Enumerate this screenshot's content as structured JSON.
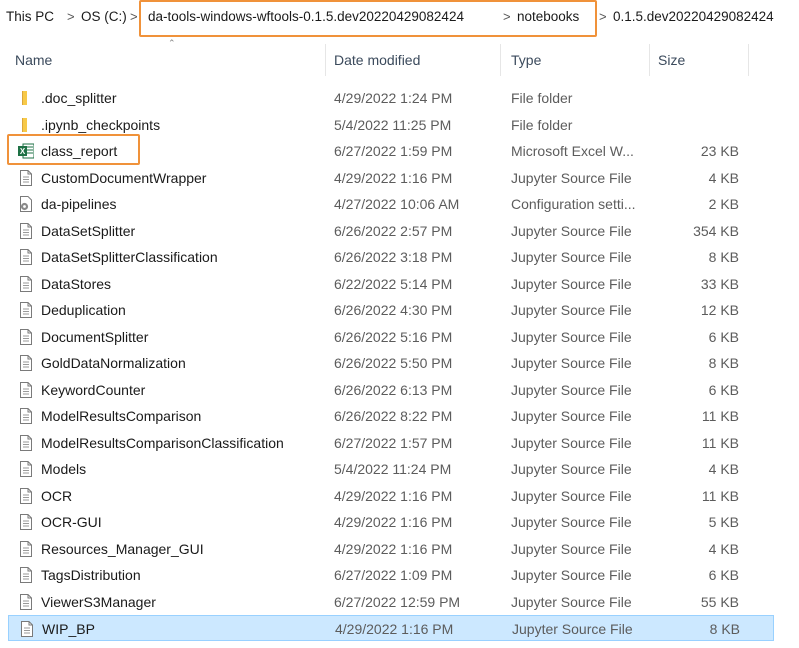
{
  "breadcrumb": {
    "items": [
      "This PC",
      "OS (C:)",
      "da-tools-windows-wftools-0.1.5.dev20220429082424",
      "notebooks",
      "0.1.5.dev20220429082424"
    ],
    "separator": ">"
  },
  "columns": {
    "name": "Name",
    "date": "Date modified",
    "type": "Type",
    "size": "Size"
  },
  "highlight_color": "#f0923a",
  "files": [
    {
      "name": ".doc_splitter",
      "date": "4/29/2022 1:24 PM",
      "type": "File folder",
      "size": "",
      "icon": "folder-icon"
    },
    {
      "name": ".ipynb_checkpoints",
      "date": "5/4/2022 11:25 PM",
      "type": "File folder",
      "size": "",
      "icon": "folder-icon"
    },
    {
      "name": "class_report",
      "date": "6/27/2022 1:59 PM",
      "type": "Microsoft Excel W...",
      "size": "23 KB",
      "icon": "excel-file-icon"
    },
    {
      "name": "CustomDocumentWrapper",
      "date": "4/29/2022 1:16 PM",
      "type": "Jupyter Source File",
      "size": "4 KB",
      "icon": "document-icon"
    },
    {
      "name": "da-pipelines",
      "date": "4/27/2022 10:06 AM",
      "type": "Configuration setti...",
      "size": "2 KB",
      "icon": "config-file-icon"
    },
    {
      "name": "DataSetSplitter",
      "date": "6/26/2022 2:57 PM",
      "type": "Jupyter Source File",
      "size": "354 KB",
      "icon": "document-icon"
    },
    {
      "name": "DataSetSplitterClassification",
      "date": "6/26/2022 3:18 PM",
      "type": "Jupyter Source File",
      "size": "8 KB",
      "icon": "document-icon"
    },
    {
      "name": "DataStores",
      "date": "6/22/2022 5:14 PM",
      "type": "Jupyter Source File",
      "size": "33 KB",
      "icon": "document-icon"
    },
    {
      "name": "Deduplication",
      "date": "6/26/2022 4:30 PM",
      "type": "Jupyter Source File",
      "size": "12 KB",
      "icon": "document-icon"
    },
    {
      "name": "DocumentSplitter",
      "date": "6/26/2022 5:16 PM",
      "type": "Jupyter Source File",
      "size": "6 KB",
      "icon": "document-icon"
    },
    {
      "name": "GoldDataNormalization",
      "date": "6/26/2022 5:50 PM",
      "type": "Jupyter Source File",
      "size": "8 KB",
      "icon": "document-icon"
    },
    {
      "name": "KeywordCounter",
      "date": "6/26/2022 6:13 PM",
      "type": "Jupyter Source File",
      "size": "6 KB",
      "icon": "document-icon"
    },
    {
      "name": "ModelResultsComparison",
      "date": "6/26/2022 8:22 PM",
      "type": "Jupyter Source File",
      "size": "11 KB",
      "icon": "document-icon"
    },
    {
      "name": "ModelResultsComparisonClassification",
      "date": "6/27/2022 1:57 PM",
      "type": "Jupyter Source File",
      "size": "11 KB",
      "icon": "document-icon"
    },
    {
      "name": "Models",
      "date": "5/4/2022 11:24 PM",
      "type": "Jupyter Source File",
      "size": "4 KB",
      "icon": "document-icon"
    },
    {
      "name": "OCR",
      "date": "4/29/2022 1:16 PM",
      "type": "Jupyter Source File",
      "size": "11 KB",
      "icon": "document-icon"
    },
    {
      "name": "OCR-GUI",
      "date": "4/29/2022 1:16 PM",
      "type": "Jupyter Source File",
      "size": "5 KB",
      "icon": "document-icon"
    },
    {
      "name": "Resources_Manager_GUI",
      "date": "4/29/2022 1:16 PM",
      "type": "Jupyter Source File",
      "size": "4 KB",
      "icon": "document-icon"
    },
    {
      "name": "TagsDistribution",
      "date": "6/27/2022 1:09 PM",
      "type": "Jupyter Source File",
      "size": "6 KB",
      "icon": "document-icon"
    },
    {
      "name": "ViewerS3Manager",
      "date": "6/27/2022 12:59 PM",
      "type": "Jupyter Source File",
      "size": "55 KB",
      "icon": "document-icon"
    },
    {
      "name": "WIP_BP",
      "date": "4/29/2022 1:16 PM",
      "type": "Jupyter Source File",
      "size": "8 KB",
      "icon": "document-icon",
      "selected": true
    }
  ]
}
